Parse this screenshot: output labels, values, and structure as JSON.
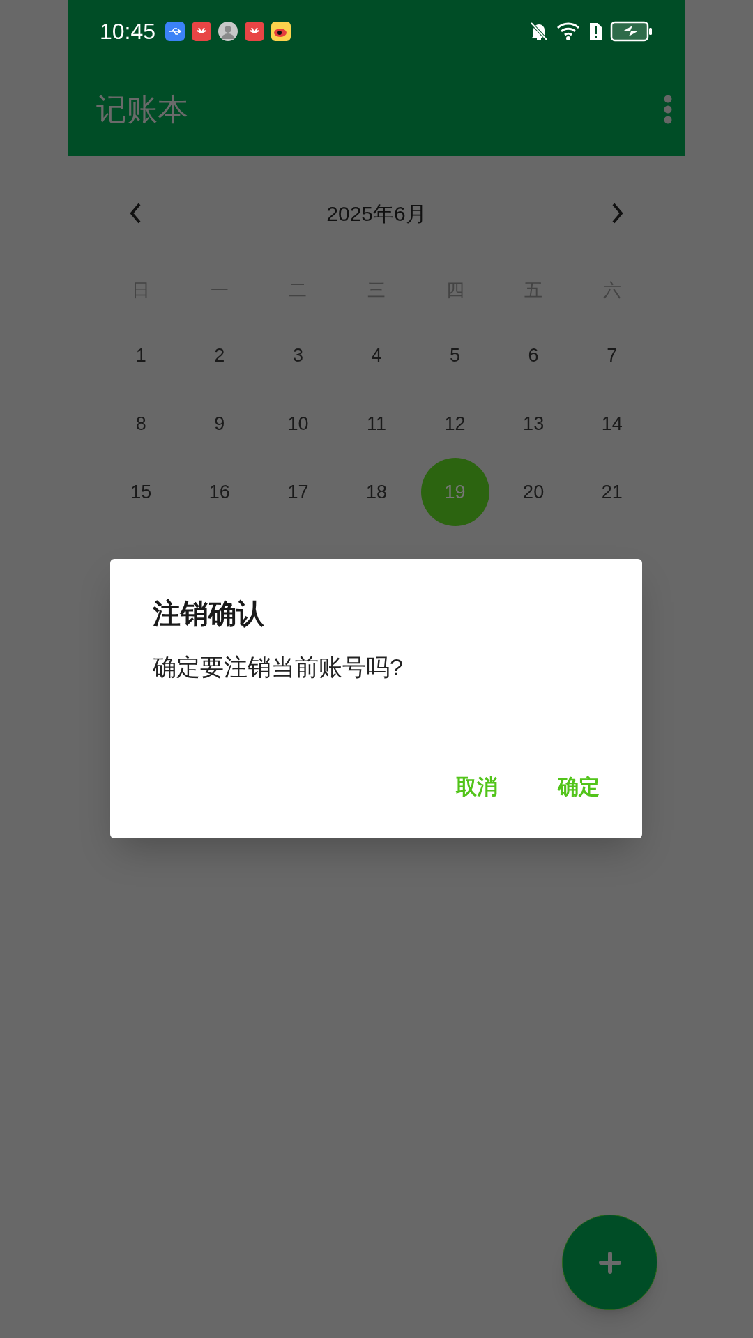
{
  "status_bar": {
    "time": "10:45"
  },
  "app_bar": {
    "title": "记账本"
  },
  "calendar": {
    "month": "2025年6月",
    "weekdays": [
      "日",
      "一",
      "二",
      "三",
      "四",
      "五",
      "六"
    ],
    "days": [
      {
        "label": "1",
        "selected": false
      },
      {
        "label": "2",
        "selected": false
      },
      {
        "label": "3",
        "selected": false
      },
      {
        "label": "4",
        "selected": false
      },
      {
        "label": "5",
        "selected": false
      },
      {
        "label": "6",
        "selected": false
      },
      {
        "label": "7",
        "selected": false
      },
      {
        "label": "8",
        "selected": false
      },
      {
        "label": "9",
        "selected": false
      },
      {
        "label": "10",
        "selected": false
      },
      {
        "label": "11",
        "selected": false
      },
      {
        "label": "12",
        "selected": false
      },
      {
        "label": "13",
        "selected": false
      },
      {
        "label": "14",
        "selected": false
      },
      {
        "label": "15",
        "selected": false
      },
      {
        "label": "16",
        "selected": false
      },
      {
        "label": "17",
        "selected": false
      },
      {
        "label": "18",
        "selected": false
      },
      {
        "label": "19",
        "selected": true
      },
      {
        "label": "20",
        "selected": false
      },
      {
        "label": "21",
        "selected": false
      }
    ]
  },
  "dialog": {
    "title": "注销确认",
    "message": "确定要注销当前账号吗?",
    "buttons": [
      "取消",
      "确定"
    ]
  }
}
